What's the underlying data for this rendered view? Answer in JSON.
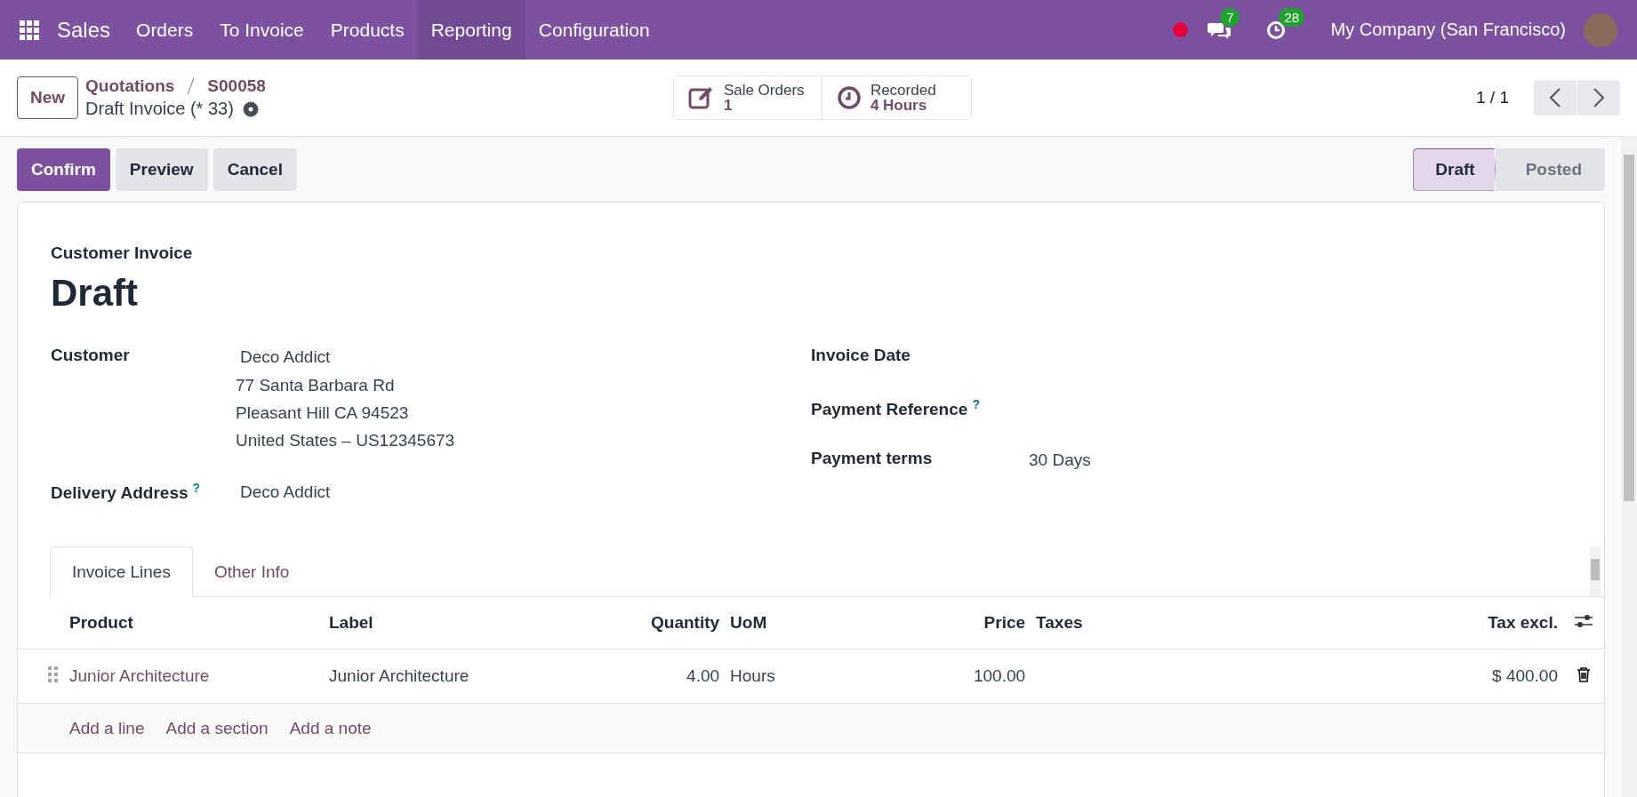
{
  "navbar": {
    "app": "Sales",
    "menu": [
      {
        "label": "Orders",
        "selected": false
      },
      {
        "label": "To Invoice",
        "selected": false
      },
      {
        "label": "Products",
        "selected": false
      },
      {
        "label": "Reporting",
        "selected": true
      },
      {
        "label": "Configuration",
        "selected": false
      }
    ],
    "messages_badge": "7",
    "activities_badge": "28",
    "company": "My Company (San Francisco)"
  },
  "control_panel": {
    "new_button": "New",
    "breadcrumb": [
      "Quotations",
      "S00058"
    ],
    "record_title": "Draft Invoice (* 33)",
    "smart_buttons": [
      {
        "kind": "edit",
        "label": "Sale Orders",
        "value": "1"
      },
      {
        "kind": "clock",
        "label": "Recorded",
        "value": "4 Hours"
      }
    ],
    "pager": "1 / 1"
  },
  "actions": [
    {
      "label": "Confirm",
      "kind": "primary"
    },
    {
      "label": "Preview",
      "kind": "secondary"
    },
    {
      "label": "Cancel",
      "kind": "secondary"
    }
  ],
  "statusbar": [
    {
      "label": "Draft",
      "selected": true
    },
    {
      "label": "Posted",
      "selected": false
    }
  ],
  "sheet": {
    "doc_type": "Customer Invoice",
    "name": "Draft",
    "left_fields": [
      {
        "label": "Customer",
        "value": "Deco Addict",
        "address": [
          "77 Santa Barbara Rd",
          "Pleasant Hill CA 94523",
          "United States – US12345673"
        ]
      },
      {
        "label": "Delivery Address",
        "help": "?",
        "value": "Deco Addict"
      }
    ],
    "right_fields": [
      {
        "label": "Invoice Date"
      },
      {
        "label": "Payment Reference",
        "help": "?"
      },
      {
        "label": "Payment terms",
        "value": "30 Days"
      }
    ],
    "tabs": [
      {
        "label": "Invoice Lines",
        "selected": true
      },
      {
        "label": "Other Info",
        "selected": false
      }
    ],
    "table": {
      "columns": [
        {
          "label": "Product"
        },
        {
          "label": "Label"
        },
        {
          "label": "Quantity"
        },
        {
          "label": "UoM"
        },
        {
          "label": "Price"
        },
        {
          "label": "Taxes"
        },
        {
          "label": "Tax excl."
        }
      ],
      "rows": [
        {
          "cells": [
            "Junior Architecture",
            "Junior Architecture",
            "4.00",
            "Hours",
            "100.00",
            "",
            "$ 400.00"
          ]
        }
      ],
      "add_links": [
        "Add a line",
        "Add a section",
        "Add a note"
      ]
    }
  }
}
